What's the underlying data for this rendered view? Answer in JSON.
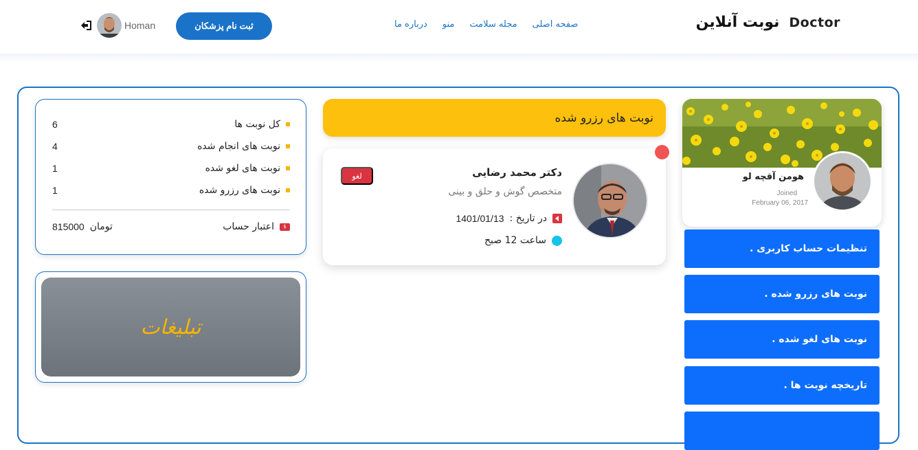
{
  "header": {
    "logo_text": "Doctor",
    "site_title": "نوبت آنلاین",
    "nav": [
      "صفحه اصلی",
      "مجله سلامت",
      "منو",
      "درباره ما"
    ],
    "register_button": "ثبت نام پزشکان",
    "username": "Homan",
    "icons": {
      "logout": "logout-icon"
    }
  },
  "stats": {
    "rows": [
      {
        "label": "کل نوبت ها",
        "value": "6"
      },
      {
        "label": "نوبت های انجام شده",
        "value": "4"
      },
      {
        "label": "نوبت های لغو شده",
        "value": "1"
      },
      {
        "label": "نوبت های رزرو شده",
        "value": "1"
      }
    ],
    "credit_label": "اعتبار حساب",
    "credit_amount": "815000",
    "credit_unit": "تومان"
  },
  "ads": {
    "text": "تبلیغات"
  },
  "reserved": {
    "title": "نوبت های رزرو شده",
    "appointment": {
      "doctor_name": "دکتر محمد رضایی",
      "specialty": "متخصص گوش و حلق و بینی",
      "cancel_label": "لغو",
      "date_label": "در تاریخ :",
      "date_value": "1401/01/13",
      "time_label": "ساعت 12 صبح"
    }
  },
  "profile": {
    "name": "هومن آقچه لو",
    "joined_label": "Joined",
    "joined_date": "February 06, 2017"
  },
  "sidebar": {
    "items": [
      {
        "label": ". تنظیمات حساب کاربری"
      },
      {
        "label": ". نوبت های رزرو شده"
      },
      {
        "label": ". نوبت های لغو شده"
      },
      {
        "label": ". تاریخچه نوبت ها"
      },
      {
        "label": ""
      }
    ]
  },
  "colors": {
    "primary": "#1a73c8",
    "menu_blue": "#0d6efd",
    "accent_yellow": "#fdc00c",
    "danger": "#d9343f"
  }
}
